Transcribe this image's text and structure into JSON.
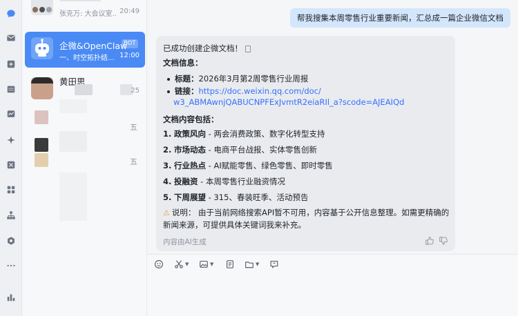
{
  "colors": {
    "accent": "#4a8af4",
    "link": "#3370ff",
    "bubble_user": "#d3e6fb",
    "card": "#e9ebee",
    "star": "#f5b300",
    "warning": "#e9a23b"
  },
  "rail": {
    "icons": [
      "chat-icon",
      "mail-icon",
      "doc-icon",
      "calendar-icon",
      "chart-icon",
      "sparkle-icon",
      "tool-icon",
      "apps-icon",
      "org-icon",
      "hex-icon",
      "more-icon",
      "stats-icon"
    ]
  },
  "conversations": [
    {
      "name": "",
      "subtitle": "张克万: 大会议室...",
      "time": "20:49"
    },
    {
      "name": "企微&OpenClaw",
      "badge": "BOT",
      "subtitle": "一、时空拓扑结...",
      "time": "12:00"
    },
    {
      "name": "黄田思",
      "subtitle": "",
      "time": "25"
    },
    {
      "name": "",
      "subtitle": "",
      "time": "五"
    },
    {
      "name": "",
      "subtitle": "",
      "time": "五"
    }
  ],
  "chat": {
    "user_message": "帮我搜集本周零售行业重要新闻，汇总成一篇企业微信文档",
    "bot": {
      "created": "已成功创建企微文档！",
      "doc_info_heading": "文档信息：",
      "title_label": "标题：",
      "title_value": "2026年3月第2周零售行业周报",
      "link_label": "链接：",
      "link_line1": "https://doc.weixin.qq.com/doc/",
      "link_line2": "w3_ABMAwnjQABUCNPFExJvmtR2eiaRIl_a?scode=AJEAIQd",
      "content_heading": "文档内容包括：",
      "items": [
        {
          "num": "1.",
          "label": "政策风向",
          "desc": " - 两会消费政策、数字化转型支持"
        },
        {
          "num": "2.",
          "label": "市场动态",
          "desc": " - 电商平台战报、实体零售创新"
        },
        {
          "num": "3.",
          "label": "行业热点",
          "desc": " - AI赋能零售、绿色零售、即时零售"
        },
        {
          "num": "4.",
          "label": "投融资",
          "desc": " - 本周零售行业融资情况"
        },
        {
          "num": "5.",
          "label": "下周展望",
          "desc": " - 315、春装旺季、活动预告"
        }
      ],
      "note_line1": "说明：  由于当前网络搜索API暂不可用，内容基于公开信息整理。如需更精确的",
      "note_line2": "新闻来源，可提供具体关键词我来补充。",
      "ai_footer": "内容由AI生成"
    }
  },
  "composer": {
    "tools": [
      "emoji-icon",
      "scissors-icon",
      "image-icon",
      "doc-icon",
      "folder-icon",
      "quote-icon"
    ]
  }
}
